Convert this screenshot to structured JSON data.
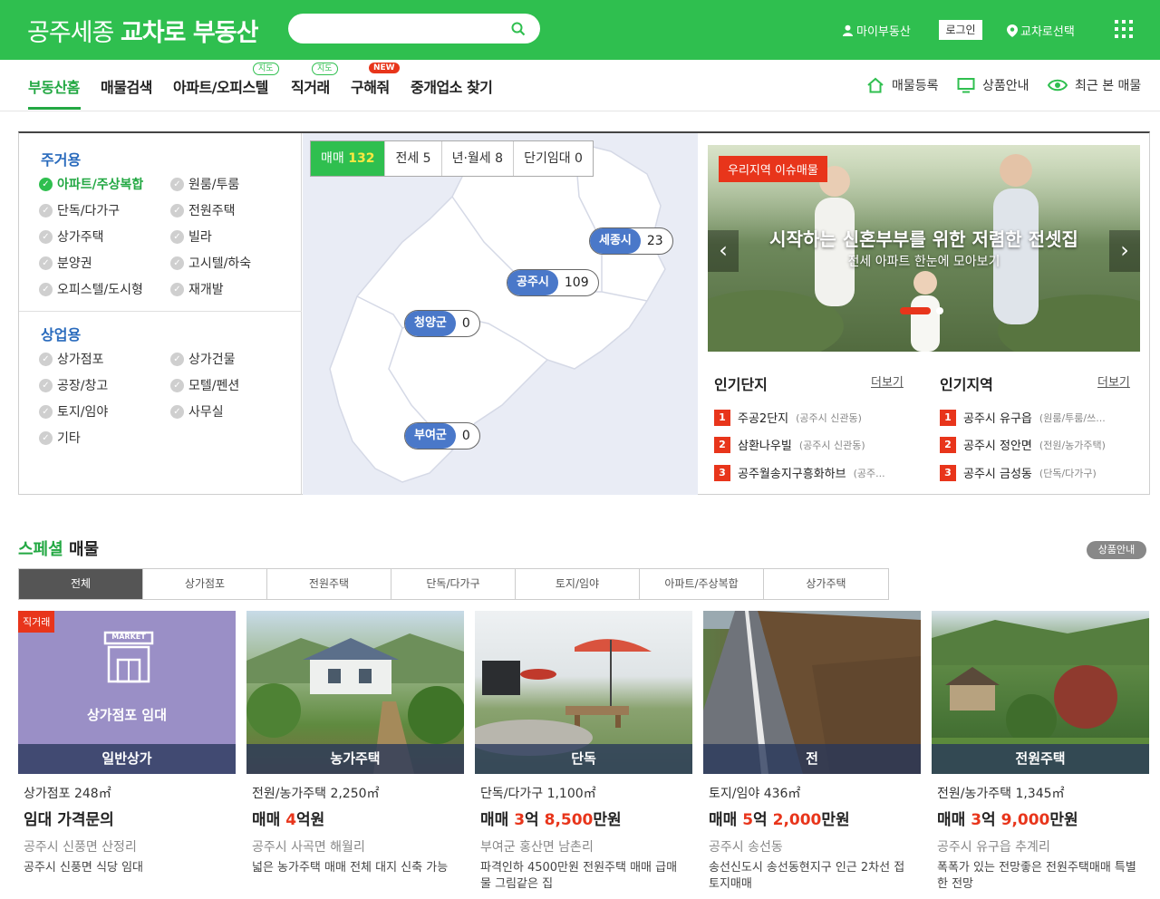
{
  "header": {
    "logo_light": "공주세종",
    "logo_bold": "교차로 부동산",
    "search_placeholder": "",
    "my_label": "마이부동산",
    "login_label": "로그인",
    "region_label": "교차로선택"
  },
  "nav": {
    "items": [
      {
        "label": "부동산홈"
      },
      {
        "label": "매물검색"
      },
      {
        "label": "아파트/오피스텔",
        "badge": "지도"
      },
      {
        "label": "직거래",
        "badge": "지도"
      },
      {
        "label": "구해줘",
        "badge": "NEW"
      },
      {
        "label": "중개업소 찾기"
      }
    ],
    "right": [
      {
        "label": "매물등록",
        "icon": "home-icon"
      },
      {
        "label": "상품안내",
        "icon": "monitor-icon"
      },
      {
        "label": "최근 본 매물",
        "icon": "eye-icon"
      }
    ]
  },
  "categories": {
    "residential_title": "주거용",
    "residential": [
      "아파트/주상복합",
      "원룸/투룸",
      "단독/다가구",
      "전원주택",
      "상가주택",
      "빌라",
      "분양권",
      "고시텔/하숙",
      "오피스텔/도시형",
      "재개발"
    ],
    "commercial_title": "상업용",
    "commercial": [
      "상가점포",
      "상가건물",
      "공장/창고",
      "모텔/펜션",
      "토지/임야",
      "사무실",
      "기타"
    ]
  },
  "map": {
    "tabs": [
      {
        "label": "매매",
        "count": "132"
      },
      {
        "label": "전세",
        "count": "5"
      },
      {
        "label": "년·월세",
        "count": "8"
      },
      {
        "label": "단기임대",
        "count": "0"
      }
    ],
    "pins": [
      {
        "name": "세종시",
        "count": "23"
      },
      {
        "name": "공주시",
        "count": "109"
      },
      {
        "name": "청양군",
        "count": "0"
      },
      {
        "name": "부여군",
        "count": "0"
      }
    ]
  },
  "banner": {
    "tag": "우리지역 이슈매물",
    "title": "시작하는 신혼부부를 위한 저렴한 전셋집",
    "subtitle": "전세 아파트 한눈에 모아보기"
  },
  "popular_complex": {
    "title": "인기단지",
    "more": "더보기",
    "items": [
      {
        "name": "주공2단지",
        "sub": "(공주시 신관동)"
      },
      {
        "name": "삼환나우빌",
        "sub": "(공주시 신관동)"
      },
      {
        "name": "공주월송지구흥화하브",
        "sub": "(공주..."
      }
    ]
  },
  "popular_region": {
    "title": "인기지역",
    "more": "더보기",
    "items": [
      {
        "name": "공주시 유구읍",
        "sub": "(원룸/투룸/쓰..."
      },
      {
        "name": "공주시 정안면",
        "sub": "(전원/농가주택)"
      },
      {
        "name": "공주시 금성동",
        "sub": "(단독/다가구)"
      }
    ]
  },
  "special": {
    "title_green": "스페셜",
    "title_rest": " 매물",
    "info_btn": "상품안내",
    "tabs": [
      "전체",
      "상가점포",
      "전원주택",
      "단독/다가구",
      "토지/임야",
      "아파트/주상복합",
      "상가주택"
    ]
  },
  "listings": [
    {
      "tag": "직거래",
      "thumb_text": "상가점포 임대",
      "market_text": "MARKET",
      "caption": "일반상가",
      "type": "상가점포",
      "area": "248㎡",
      "price_pre": "임대 가격문의",
      "price_em1": "",
      "price_mid": "",
      "price_em2": "",
      "price_post": "",
      "addr": "공주시 신풍면 산정리",
      "desc": "공주시 신풍면 식당 임대"
    },
    {
      "caption": "농가주택",
      "type": "전원/농가주택",
      "area": "2,250㎡",
      "price_pre": "매매 ",
      "price_em1": "4",
      "price_mid": "억원",
      "price_em2": "",
      "price_post": "",
      "addr": "공주시 사곡면 해월리",
      "desc": "넓은 농가주택 매매 전체 대지 신축 가능"
    },
    {
      "caption": "단독",
      "type": "단독/다가구",
      "area": "1,100㎡",
      "price_pre": "매매 ",
      "price_em1": "3",
      "price_mid": "억 ",
      "price_em2": "8,500",
      "price_post": "만원",
      "addr": "부여군 홍산면 남촌리",
      "desc": "파격인하 4500만원 전원주택 매매 급매물 그림같은 집"
    },
    {
      "caption": "전",
      "type": "토지/임야",
      "area": "436㎡",
      "price_pre": "매매 ",
      "price_em1": "5",
      "price_mid": "억 ",
      "price_em2": "2,000",
      "price_post": "만원",
      "addr": "공주시 송선동",
      "desc": "송선신도시 송선동현지구 인근 2차선 접 토지매매"
    },
    {
      "caption": "전원주택",
      "type": "전원/농가주택",
      "area": "1,345㎡",
      "price_pre": "매매 ",
      "price_em1": "3",
      "price_mid": "억 ",
      "price_em2": "9,000",
      "price_post": "만원",
      "addr": "공주시 유구읍 추계리",
      "desc": "폭폭가 있는 전망좋은 전원주택매매 특별한 전망"
    }
  ],
  "colors": {
    "brand": "#2fbf4f",
    "accent": "#e8351b",
    "pin": "#4a78c9"
  }
}
